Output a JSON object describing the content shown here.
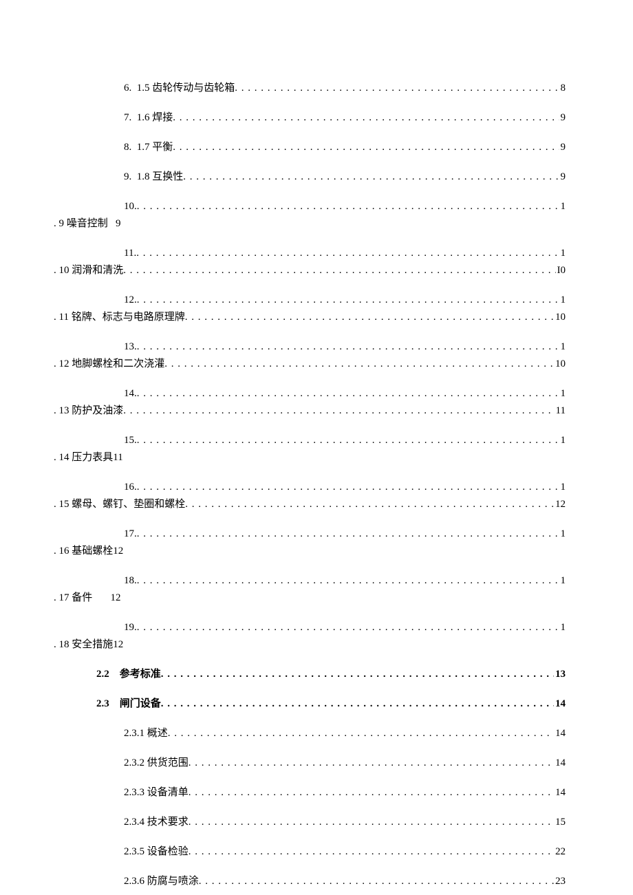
{
  "toc": {
    "simple": [
      {
        "label": "6.  1.5 齿轮传动与齿轮箱",
        "page": "8",
        "indent": "indent2"
      },
      {
        "label": "7.  1.6 焊接",
        "page": "9",
        "indent": "indent2"
      },
      {
        "label": "8.  1.7 平衡",
        "page": "9",
        "indent": "indent2"
      },
      {
        "label": "9.  1.8 互换性",
        "page": "9",
        "indent": "indent2"
      }
    ],
    "wrapped": [
      {
        "num": "10.",
        "line2_label": ". 9 噪音控制   9",
        "line2_hasdots": false,
        "line2_page": ""
      },
      {
        "num": "11.",
        "line2_label": ". 10 润滑和清洗",
        "line2_hasdots": true,
        "line2_page": "I0"
      },
      {
        "num": "12.",
        "line2_label": ". 11 铭牌、标志与电路原理牌",
        "line2_hasdots": true,
        "line2_page": "10"
      },
      {
        "num": "13.",
        "line2_label": ". 12 地脚螺栓和二次浇灌",
        "line2_hasdots": true,
        "line2_page": "10"
      },
      {
        "num": "14.",
        "line2_label": ". 13 防护及油漆",
        "line2_hasdots": true,
        "line2_page": "11"
      },
      {
        "num": "15.",
        "line2_label": ". 14 压力表具11",
        "line2_hasdots": false,
        "line2_page": ""
      },
      {
        "num": "16.",
        "line2_label": ". 15 螺母、螺钉、垫圈和螺栓",
        "line2_hasdots": true,
        "line2_page": "12"
      },
      {
        "num": "17.",
        "line2_label": ". 16 基础螺栓12",
        "line2_hasdots": false,
        "line2_page": ""
      },
      {
        "num": "18.",
        "line2_label": ". 17 备件       12",
        "line2_hasdots": false,
        "line2_page": ""
      },
      {
        "num": "19.",
        "line2_label": ". 18 安全措施12",
        "line2_hasdots": false,
        "line2_page": ""
      }
    ],
    "sections": [
      {
        "label": "2.2    参考标准",
        "page": "13",
        "bold": true,
        "indent": "indent1"
      },
      {
        "label": "2.3    闸门设备",
        "page": "14",
        "bold": true,
        "indent": "indent1"
      },
      {
        "label": "2.3.1 概述",
        "page": "14",
        "bold": false,
        "indent": "indent2"
      },
      {
        "label": "2.3.2 供货范围",
        "page": "14",
        "bold": false,
        "indent": "indent2"
      },
      {
        "label": "2.3.3 设备清单",
        "page": "14",
        "bold": false,
        "indent": "indent2"
      },
      {
        "label": "2.3.4 技术要求",
        "page": "15",
        "bold": false,
        "indent": "indent2"
      },
      {
        "label": "2.3.5 设备检验",
        "page": "22",
        "bold": false,
        "indent": "indent2"
      },
      {
        "label": "2.3.6 防腐与喷涂",
        "page": "23",
        "bold": false,
        "indent": "indent2"
      }
    ]
  }
}
